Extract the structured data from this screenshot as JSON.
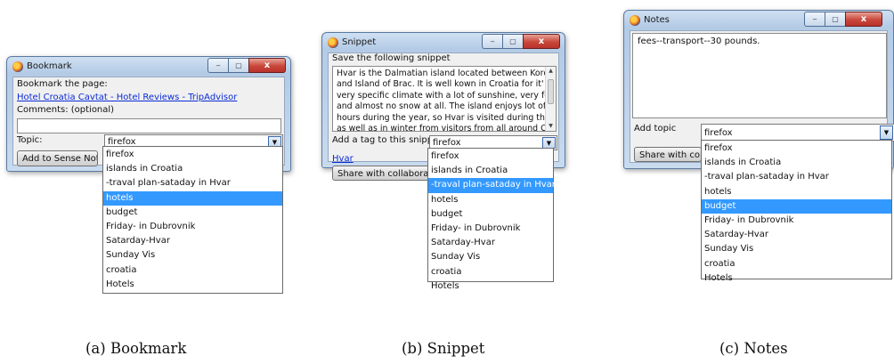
{
  "bookmark": {
    "title": "Bookmark",
    "bookmark_label": "Bookmark the page:",
    "page_link": "Hotel Croatia Cavtat - Hotel Reviews - TripAdvisor",
    "comments_label": "Comments: (optional)",
    "comments_value": "",
    "topic_label": "Topic:",
    "topic_value": "firefox",
    "add_button": "Add to Sense Note",
    "options": [
      "firefox",
      "islands in Croatia",
      "-traval plan-sataday in Hvar",
      "hotels",
      "budget",
      "Friday- in Dubrovnik",
      "Satarday-Hvar",
      "Sunday Vis",
      "croatia",
      "Hotels"
    ],
    "selected_index": 3
  },
  "snippet": {
    "title": "Snippet",
    "save_label": "Save the following snippet",
    "snippet_lines": [
      "Hvar is the Dalmatian island located between Korcula Island",
      "and Island of Brac. It is well kown in Croatia for it'  s pleasant,",
      "very specific climate with a lot of sunshine, very few rainy days",
      "and almost no snow at all. The island enjoys lot of sunshine",
      "hours during the year, so Hvar is visited during the summer",
      "as well as in winter from visitors from all around Croatia and"
    ],
    "tag_label": "Add a tag to this snippet",
    "tag_value": "firefox",
    "link": "Hvar",
    "share_button": "Share with collaborators",
    "options": [
      "firefox",
      "islands in Croatia",
      "-traval plan-sataday in Hvar",
      "hotels",
      "budget",
      "Friday- in Dubrovnik",
      "Satarday-Hvar",
      "Sunday Vis",
      "croatia",
      "Hotels"
    ],
    "selected_index": 2
  },
  "notes": {
    "title": "Notes",
    "note_text": "fees--transport--30 pounds.",
    "topic_label": "Add topic",
    "topic_value": "firefox",
    "share_button": "Share with collab",
    "options": [
      "firefox",
      "islands in Croatia",
      "-traval plan-sataday in Hvar",
      "hotels",
      "budget",
      "Friday- in Dubrovnik",
      "Satarday-Hvar",
      "Sunday Vis",
      "croatia",
      "Hotels"
    ],
    "selected_index": 4
  },
  "captions": {
    "a": "(a) Bookmark",
    "b": "(b) Snippet",
    "c": "(c) Notes"
  },
  "window_controls": {
    "minimize": "‒",
    "maximize": "▢",
    "close": "x"
  }
}
